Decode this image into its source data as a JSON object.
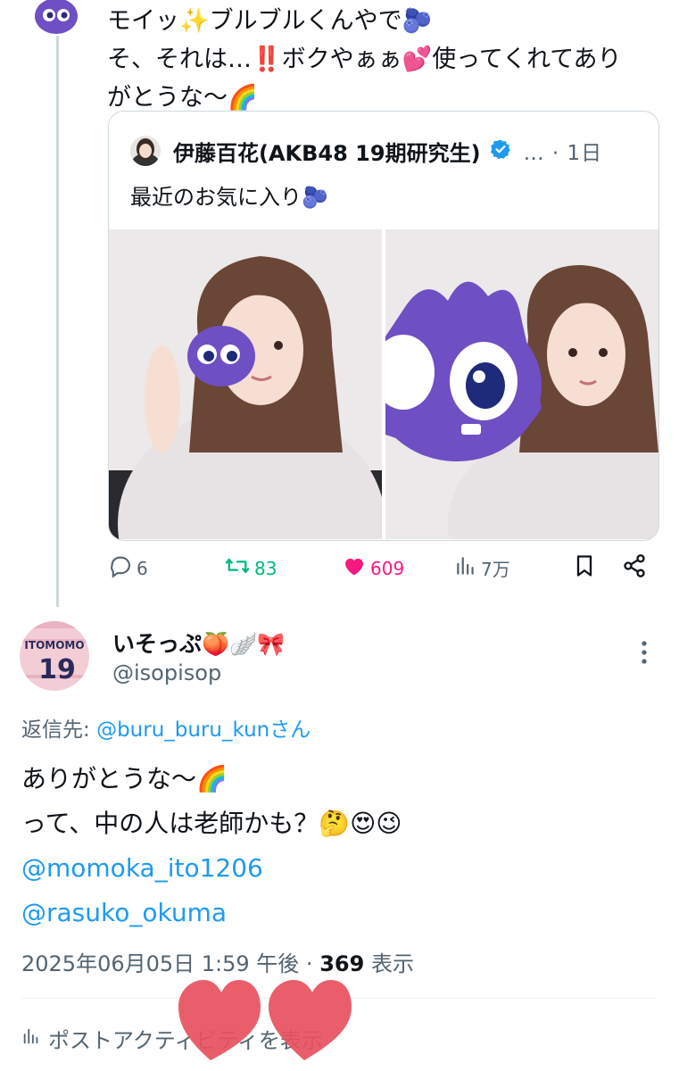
{
  "parent_tweet": {
    "lines": [
      "モイッ✨ブルブルくんやで🫐",
      "そ、それは…‼️ボクやぁぁ💕使ってくれてあり",
      "がとうな〜🌈"
    ]
  },
  "quote": {
    "author_name": "伊藤百花(AKB48 19期研究生)",
    "meta": "… · 1日",
    "text": "最近のお気に入り🫐"
  },
  "actions": {
    "replies": "6",
    "reposts": "83",
    "likes": "609",
    "views": "7万"
  },
  "reply_tweet": {
    "display_name": "いそっぷ🍑🪽🎀",
    "handle": "@isopisop",
    "reply_to_label": "返信先: ",
    "reply_to_handle": "@buru_buru_kunさん",
    "line1": "ありがとうな〜🌈",
    "line2": "って、中の人は老師かも？🤔😍😉",
    "mention1": "@momoka_ito1206",
    "mention2": "@rasuko_okuma",
    "timestamp": "2025年06月05日 1:59 午後 · ",
    "view_count": "369",
    "view_suffix": " 表示",
    "analytics_label": "ポストアクティビティを表示",
    "avatar_text_top": "ITOMOMO",
    "avatar_text_num": "19"
  },
  "colors": {
    "accent": "#1d9bf0",
    "repost": "#00ba7c",
    "like": "#f91880",
    "muted": "#536471",
    "mascot": "#6f4fc4"
  },
  "icons": [
    "mascot-avatar-icon",
    "verified-badge-icon",
    "reply-icon",
    "repost-icon",
    "heart-icon",
    "views-icon",
    "bookmark-icon",
    "share-icon",
    "more-icon",
    "analytics-icon"
  ]
}
